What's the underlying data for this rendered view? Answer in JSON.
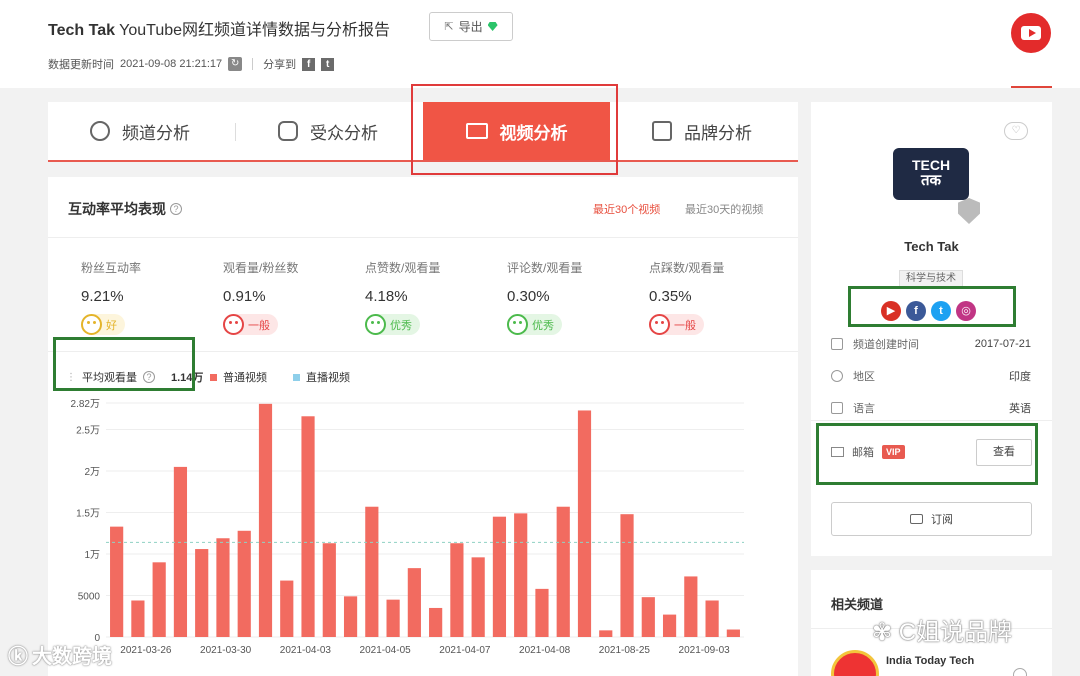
{
  "header": {
    "channel": "Tech Tak",
    "title_suffix": " YouTube网红频道详情数据与分析报告",
    "export_label": "导出",
    "update_label": "数据更新时间",
    "update_time": "2021-09-08 21:21:17",
    "share_label": "分享到"
  },
  "tabs": [
    {
      "label": "频道分析",
      "icon": "globe-icon"
    },
    {
      "label": "受众分析",
      "icon": "audience-icon"
    },
    {
      "label": "视频分析",
      "icon": "video-icon",
      "active": true
    },
    {
      "label": "品牌分析",
      "icon": "brand-icon"
    }
  ],
  "engagement": {
    "title": "互动率平均表现",
    "filters": [
      "最近30个视频",
      "最近30天的视频"
    ],
    "active_filter": "最近30个视频",
    "metrics": [
      {
        "label": "粉丝互动率",
        "value": "9.21%",
        "rating": "好",
        "tone": "ok"
      },
      {
        "label": "观看量/粉丝数",
        "value": "0.91%",
        "rating": "一般",
        "tone": "bad"
      },
      {
        "label": "点赞数/观看量",
        "value": "4.18%",
        "rating": "优秀",
        "tone": "good"
      },
      {
        "label": "评论数/观看量",
        "value": "0.30%",
        "rating": "优秀",
        "tone": "good"
      },
      {
        "label": "点踩数/观看量",
        "value": "0.35%",
        "rating": "一般",
        "tone": "bad"
      }
    ]
  },
  "legend": {
    "avg_label": "平均观看量",
    "avg_value": "1.14万",
    "series_normal": "普通视频",
    "series_live": "直播视频",
    "color_normal": "#f26b60",
    "color_live": "#8ecfea"
  },
  "chart_data": {
    "type": "bar",
    "series": [
      {
        "name": "普通视频",
        "values": [
          1.33,
          0.44,
          0.9,
          2.05,
          1.06,
          1.19,
          1.28,
          2.81,
          0.68,
          2.66,
          1.13,
          0.49,
          1.57,
          0.45,
          0.83,
          0.35,
          1.13,
          0.96,
          1.45,
          1.49,
          0.58,
          1.57,
          2.73,
          0.08,
          1.48,
          0.48,
          0.27,
          0.73,
          0.44,
          0.09
        ]
      }
    ],
    "average": 1.14,
    "x_tick_labels": [
      "2021-03-26",
      "2021-03-30",
      "2021-04-03",
      "2021-04-05",
      "2021-04-07",
      "2021-04-08",
      "2021-08-25",
      "2021-09-03"
    ],
    "y_tick_labels": [
      "0",
      "5000",
      "1万",
      "1.5万",
      "2万",
      "2.5万",
      "2.82万"
    ],
    "y_tick_values": [
      0,
      0.5,
      1.0,
      1.5,
      2.0,
      2.5,
      2.82
    ],
    "ylim": [
      0,
      2.82
    ],
    "ylabel": "",
    "xlabel": ""
  },
  "side": {
    "logo_line1": "TECH",
    "logo_line2": "तक",
    "channel_name": "Tech Tak",
    "category": "科学与技术",
    "info": [
      {
        "label": "频道创建时间",
        "value": "2017-07-21"
      },
      {
        "label": "地区",
        "value": "印度"
      },
      {
        "label": "语言",
        "value": "英语"
      }
    ],
    "email_label": "邮箱",
    "vip_label": "VIP",
    "view_label": "查看",
    "subscribe_label": "订阅",
    "related_title": "相关频道",
    "related_name": "India Today Tech"
  },
  "watermarks": {
    "left": "大数跨境",
    "right": "C姐说品牌"
  }
}
